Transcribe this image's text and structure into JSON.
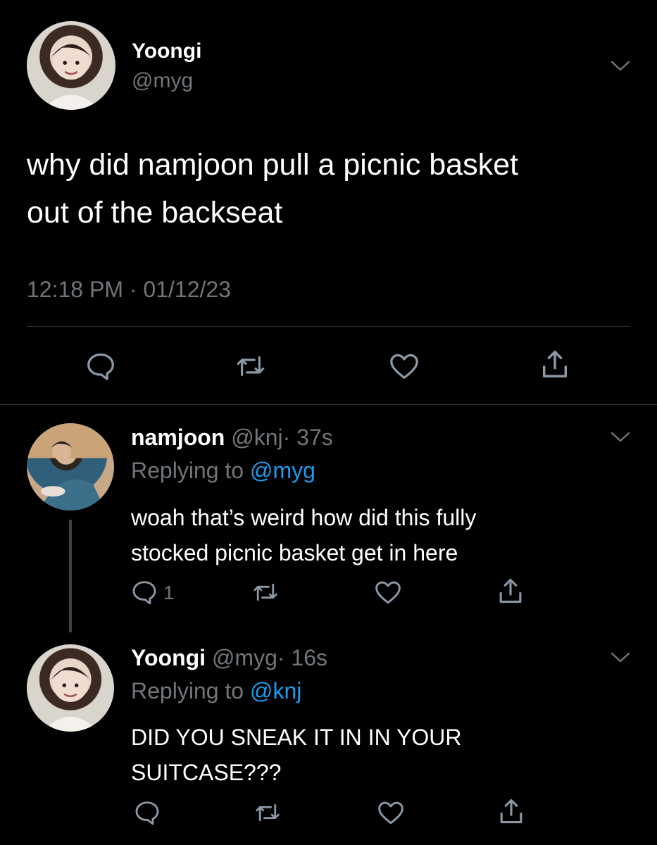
{
  "main_tweet": {
    "display_name": "Yoongi",
    "handle": "@myg",
    "text_line1": "why did namjoon pull a picnic basket",
    "text_line2": "out of the backseat",
    "timestamp": "12:18 PM · 01/12/23"
  },
  "reply1": {
    "display_name": "namjoon",
    "handle": "@knj",
    "age": "· 37s",
    "replying_prefix": "Replying to",
    "replying_to": "@myg",
    "text_line1": "woah that’s weird how did this fully",
    "text_line2": "stocked picnic basket get in here",
    "reply_count": "1"
  },
  "reply2": {
    "display_name": "Yoongi",
    "handle": "@myg",
    "age": "· 16s",
    "replying_prefix": "Replying to",
    "replying_to": "@knj",
    "text_line1": "DID YOU SNEAK IT IN IN YOUR",
    "text_line2": "SUITCASE???"
  },
  "icons": [
    "chevron-down-icon",
    "reply-icon",
    "retweet-icon",
    "like-icon",
    "share-icon"
  ],
  "colors": {
    "background": "#000000",
    "text": "#ffffff",
    "muted": "#71767b",
    "link": "#1d9bf0",
    "divider": "#2f3336"
  }
}
